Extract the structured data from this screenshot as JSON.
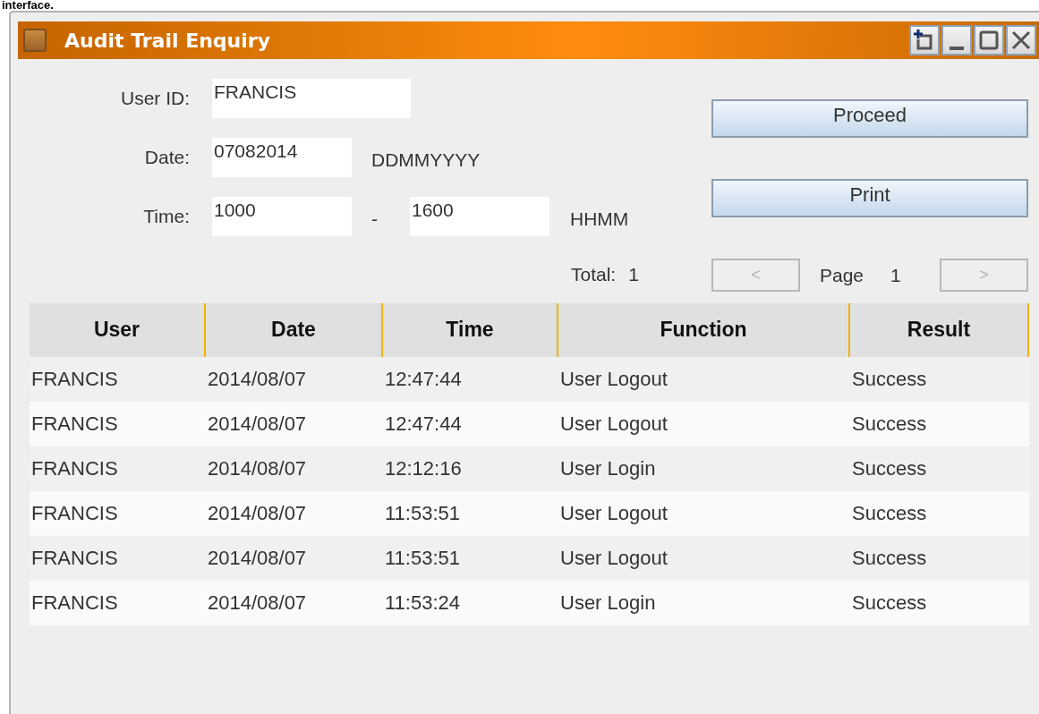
{
  "caption": "interface.",
  "window": {
    "title": "Audit Trail Enquiry"
  },
  "form": {
    "user_id": {
      "label": "User ID:",
      "value": "FRANCIS"
    },
    "date": {
      "label": "Date:",
      "value": "07082014",
      "format": "DDMMYYYY"
    },
    "time": {
      "label": "Time:",
      "from": "1000",
      "separator": "-",
      "to": "1600",
      "format": "HHMM"
    }
  },
  "buttons": [
    "Proceed",
    "Print"
  ],
  "total": {
    "label": "Total:",
    "value": "1"
  },
  "pager": {
    "prev": {
      "label": "<",
      "disabled": true
    },
    "page_label": "Page",
    "page": "1",
    "next": {
      "label": ">",
      "disabled": true
    }
  },
  "table": {
    "columns": [
      "User",
      "Date",
      "Time",
      "Function",
      "Result"
    ],
    "rows": [
      [
        "FRANCIS",
        "2014/08/07",
        "12:47:44",
        "User Logout",
        "Success"
      ],
      [
        "FRANCIS",
        "2014/08/07",
        "12:47:44",
        "User Logout",
        "Success"
      ],
      [
        "FRANCIS",
        "2014/08/07",
        "12:12:16",
        "User Login",
        "Success"
      ],
      [
        "FRANCIS",
        "2014/08/07",
        "11:53:51",
        "User Logout",
        "Success"
      ],
      [
        "FRANCIS",
        "2014/08/07",
        "11:53:51",
        "User Logout",
        "Success"
      ],
      [
        "FRANCIS",
        "2014/08/07",
        "11:53:24",
        "User Login",
        "Success"
      ]
    ]
  }
}
